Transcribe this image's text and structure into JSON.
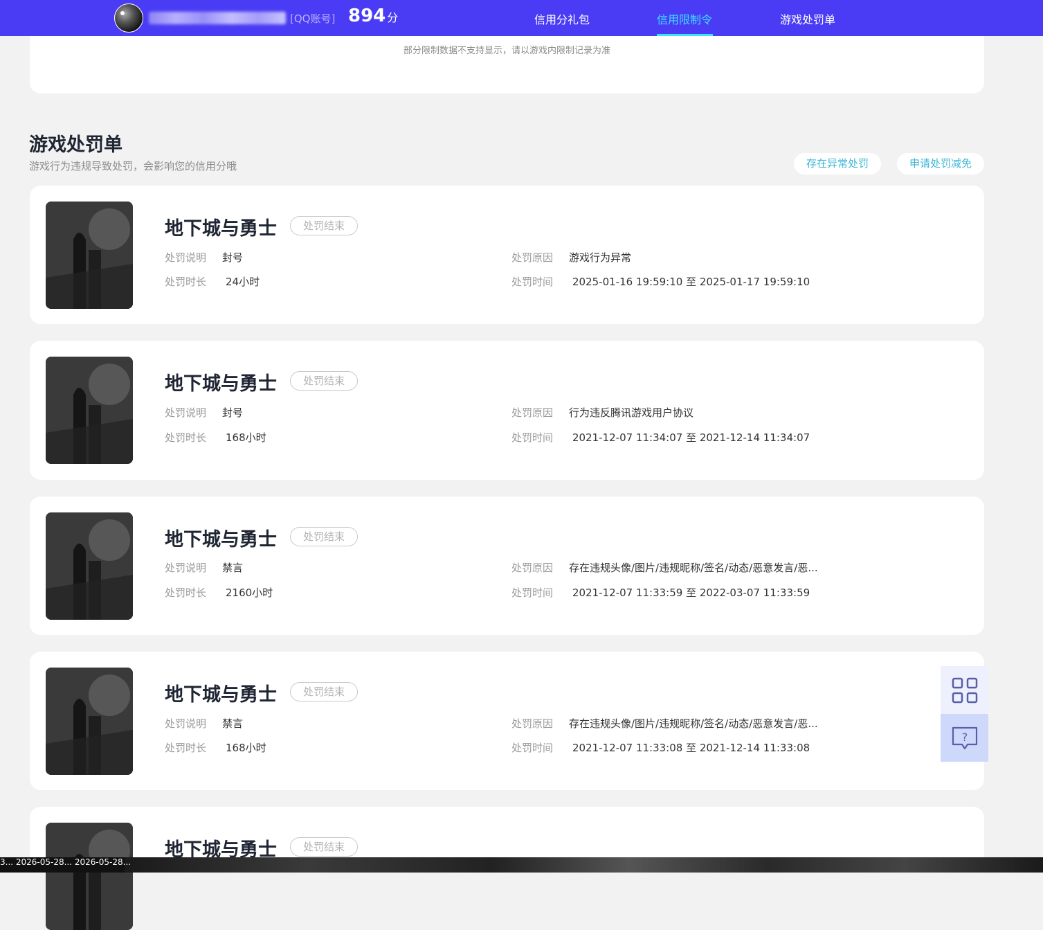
{
  "header": {
    "account_tag": "[QQ账号]",
    "score_value": "894",
    "score_unit": "分",
    "nav": [
      {
        "label": "信用分礼包",
        "active": false
      },
      {
        "label": "信用限制令",
        "active": true
      },
      {
        "label": "游戏处罚单",
        "active": false
      }
    ],
    "accent_color": "#4a3cf5",
    "active_color": "#3ee2ff"
  },
  "restriction_notice": "部分限制数据不支持显示，请以游戏内限制记录为准",
  "penalty_section": {
    "title": "游戏处罚单",
    "subtitle": "游戏行为违规导致处罚，会影响您的信用分哦",
    "buttons": {
      "abnormal": "存在异常处罚",
      "appeal": "申请处罚减免"
    },
    "labels": {
      "desc": "处罚说明",
      "duration": "处罚时长",
      "reason": "处罚原因",
      "time": "处罚时间"
    },
    "records": [
      {
        "game": "地下城与勇士",
        "status": "处罚结束",
        "desc": "封号",
        "duration": "24小时",
        "reason": "游戏行为异常",
        "time": "2025-01-16 19:59:10 至 2025-01-17 19:59:10"
      },
      {
        "game": "地下城与勇士",
        "status": "处罚结束",
        "desc": "封号",
        "duration": "168小时",
        "reason": "行为违反腾讯游戏用户协议",
        "time": "2021-12-07 11:34:07 至 2021-12-14 11:34:07"
      },
      {
        "game": "地下城与勇士",
        "status": "处罚结束",
        "desc": "禁言",
        "duration": "2160小时",
        "reason": "存在违规头像/图片/违规昵称/签名/动态/恶意发言/恶...",
        "time": "2021-12-07 11:33:59 至 2022-03-07 11:33:59"
      },
      {
        "game": "地下城与勇士",
        "status": "处罚结束",
        "desc": "禁言",
        "duration": "168小时",
        "reason": "存在违规头像/图片/违规昵称/签名/动态/恶意发言/恶...",
        "time": "2021-12-07 11:33:08 至 2021-12-14 11:33:08"
      },
      {
        "game": "地下城与勇士",
        "status": "处罚结束"
      }
    ]
  },
  "side_tools": {
    "qr_icon": "qr-code-icon",
    "help_icon": "help-chat-icon",
    "help_glyph": "?"
  },
  "taskbar": {
    "text": "3... 2026-05-28... 2026-05-28..."
  }
}
